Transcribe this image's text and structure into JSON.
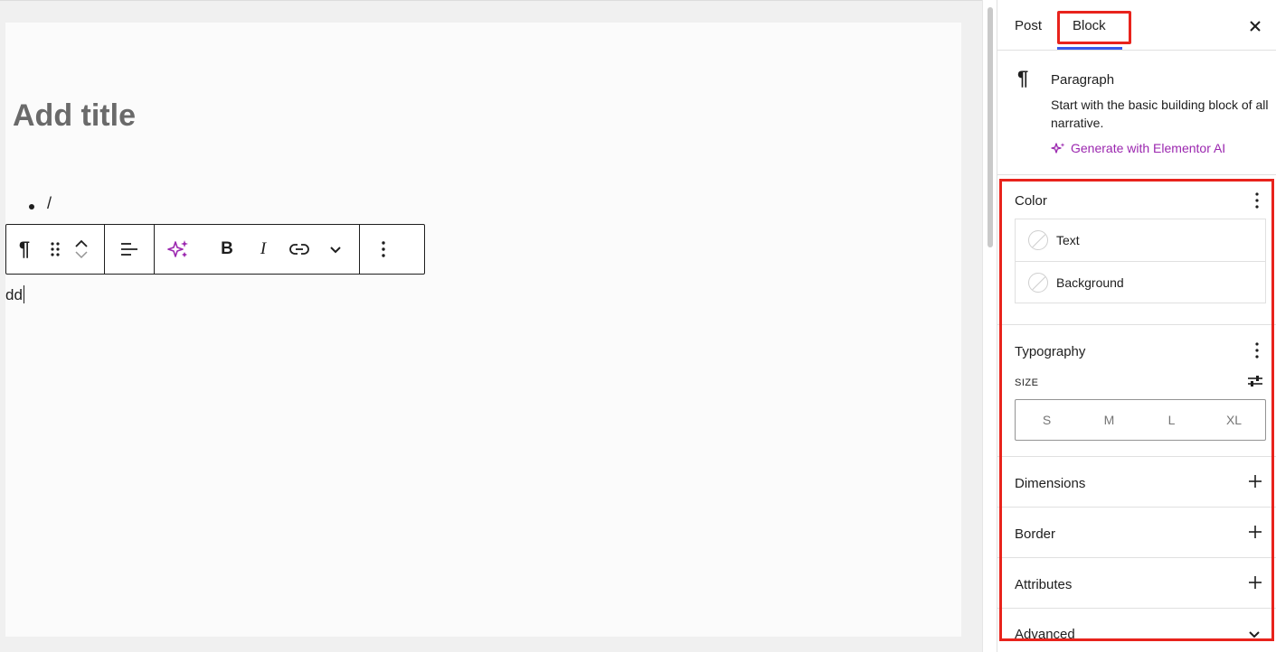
{
  "editor": {
    "title_placeholder": "Add title",
    "list_item_text": "/",
    "paragraph_text": "dd"
  },
  "toolbar": {
    "items": [
      "paragraph-icon",
      "drag-handle-icon",
      "move-up-icon",
      "move-down-icon",
      "align-left-icon",
      "ai-sparkle-icon",
      "bold-icon",
      "italic-icon",
      "link-icon",
      "chevron-down-icon",
      "more-options-icon"
    ],
    "bold_label": "B",
    "italic_label": "I",
    "paragraph_glyph": "¶"
  },
  "sidebar": {
    "tabs": [
      {
        "label": "Post",
        "active": false
      },
      {
        "label": "Block",
        "active": true
      }
    ],
    "close_label": "×",
    "block": {
      "icon": "¶",
      "name": "Paragraph",
      "description": "Start with the basic building block of all narrative.",
      "ai_link": "Generate with Elementor AI"
    },
    "color": {
      "title": "Color",
      "items": [
        "Text",
        "Background"
      ]
    },
    "typography": {
      "title": "Typography",
      "size_label": "SIZE",
      "sizes": [
        "S",
        "M",
        "L",
        "XL"
      ]
    },
    "panels": [
      "Dimensions",
      "Border",
      "Attributes",
      "Advanced"
    ]
  },
  "colors": {
    "highlight_red": "#e8231c",
    "accent_blue": "#3858e9",
    "ai_purple": "#9b27af"
  }
}
